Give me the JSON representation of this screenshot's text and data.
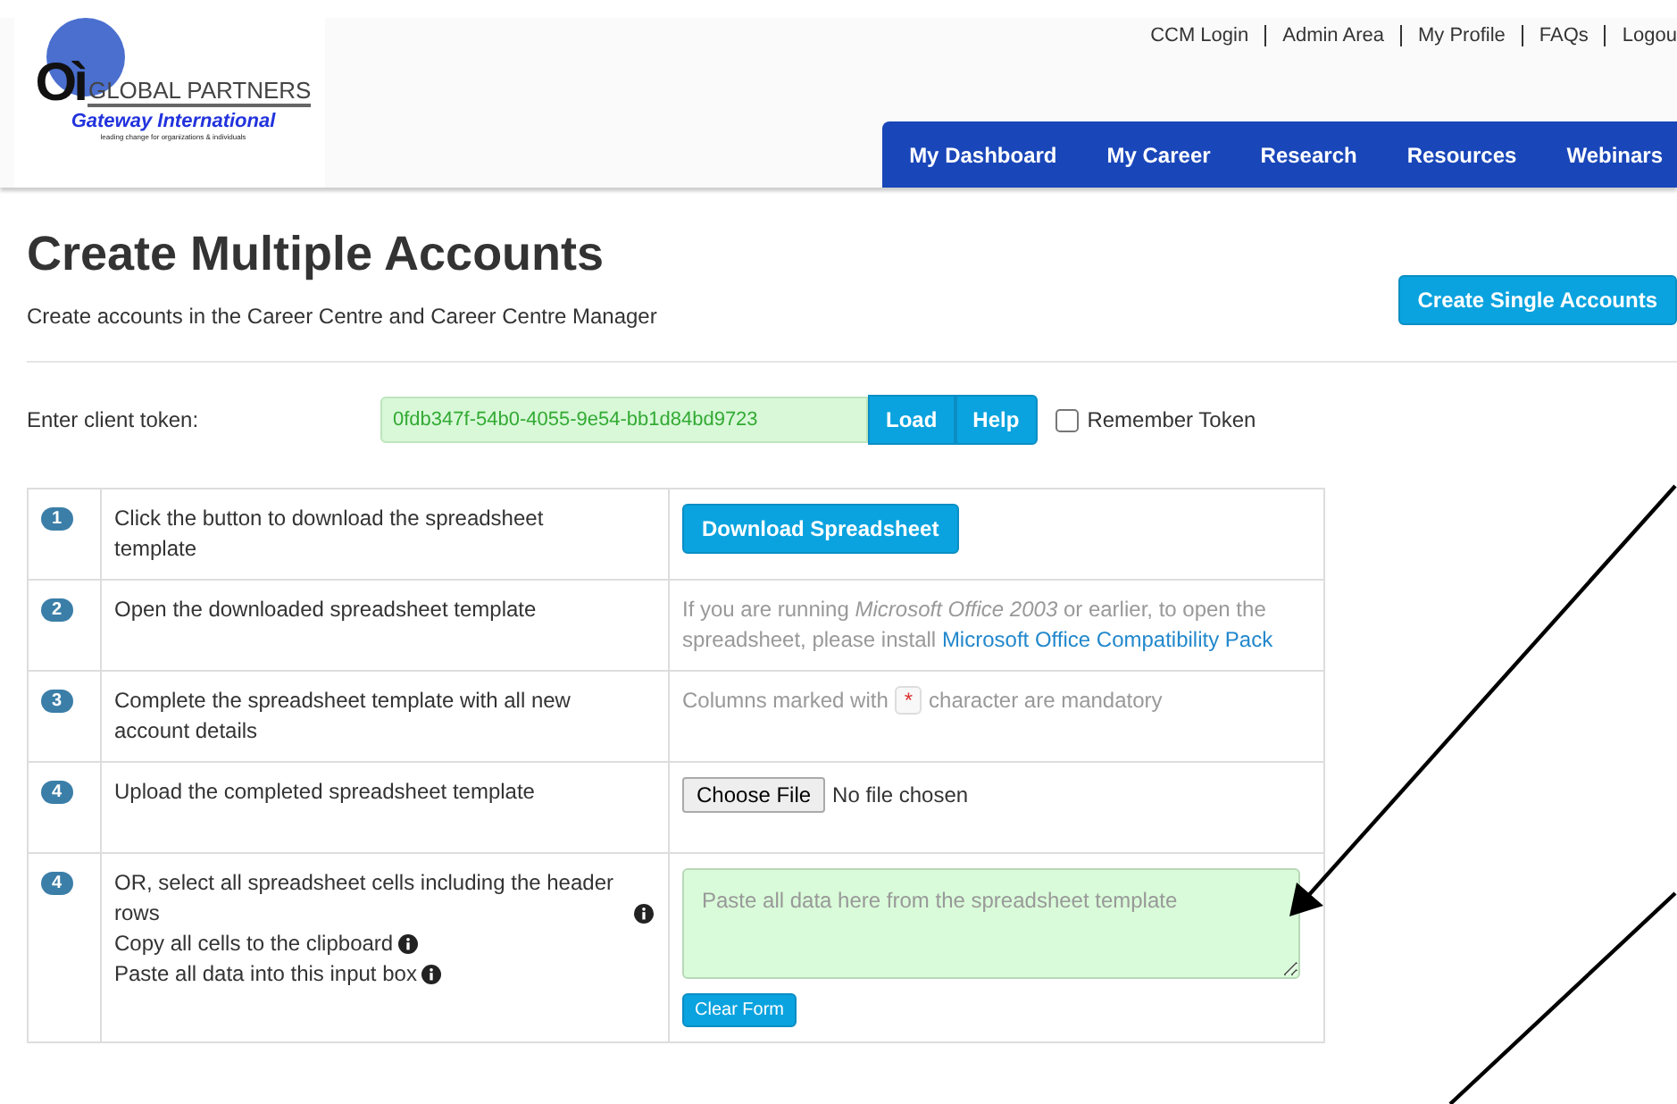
{
  "logo": {
    "mark": "Oì",
    "name": "GLOBAL PARTNERS",
    "subtitle": "Gateway International",
    "tagline": "leading change for organizations & individuals"
  },
  "top_links": [
    "CCM Login",
    "Admin Area",
    "My Profile",
    "FAQs",
    "Logou"
  ],
  "nav": [
    {
      "label": "My Dashboard",
      "selected": false
    },
    {
      "label": "My Career",
      "selected": false
    },
    {
      "label": "Research",
      "selected": false
    },
    {
      "label": "Resources",
      "selected": false
    },
    {
      "label": "Webinars",
      "selected": false
    }
  ],
  "page": {
    "title": "Create Multiple Accounts",
    "subtitle": "Create accounts in the Career Centre and Career Centre Manager",
    "action": "Create Single Accounts"
  },
  "token": {
    "label": "Enter client token:",
    "value": "0fdb347f-54b0-4055-9e54-bb1d84bd9723",
    "buttons": [
      "Load",
      "Help"
    ],
    "remember": {
      "label": "Remember Token",
      "checked": false
    }
  },
  "steps": [
    {
      "number": "1",
      "lines": [
        "Click the button to download the spreadsheet template"
      ],
      "info": false,
      "kind": "button",
      "button": "Download Spreadsheet"
    },
    {
      "number": "2",
      "lines": [
        "Open the downloaded spreadsheet template"
      ],
      "info": false,
      "kind": "note",
      "text": "If you are running *Microsoft Office 2003* or earlier, to open the spreadsheet, please install",
      "link": "Microsoft Office Compatibility Pack"
    },
    {
      "number": "3",
      "lines": [
        "Complete the spreadsheet template with all new account details"
      ],
      "info": false,
      "kind": "mandatory",
      "before": "Columns marked with",
      "mark": "*",
      "after": "character are mandatory"
    },
    {
      "number": "4",
      "lines": [
        "Upload the completed spreadsheet template"
      ],
      "info": false,
      "kind": "file",
      "button": "Choose File",
      "status": "No file chosen"
    },
    {
      "number": "4",
      "lines": [
        "OR, select all spreadsheet cells including the header rows",
        "Copy all cells to the clipboard",
        "Paste all data into this input box"
      ],
      "info": true,
      "kind": "paste",
      "placeholder": "Paste all data here from the spreadsheet template",
      "button": "Clear Form"
    }
  ]
}
